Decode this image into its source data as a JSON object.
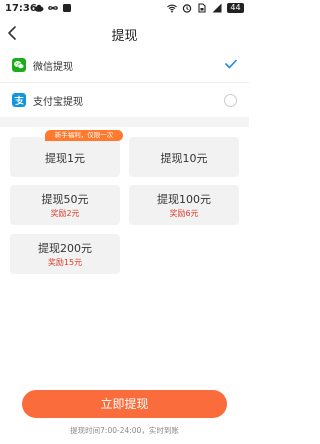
{
  "status_bar": {
    "time": "17:36",
    "battery": "44",
    "icons": [
      "cloud-icon",
      "infinity-icon",
      "app-icon",
      "wifi-icon",
      "alarm-icon",
      "sim-icon",
      "signal-icon"
    ]
  },
  "header": {
    "title": "提现",
    "back_icon": "back-arrow-icon"
  },
  "payment_methods": [
    {
      "label": "微信提现",
      "icon": "wechat-icon",
      "selected": true,
      "color": "#1aad19"
    },
    {
      "label": "支付宝提现",
      "icon": "alipay-icon",
      "selected": false,
      "color": "#1296db"
    }
  ],
  "promo_tag": "新手福利，仅限一次",
  "options": [
    {
      "label": "提现1元",
      "reward": ""
    },
    {
      "label": "提现10元",
      "reward": ""
    },
    {
      "label": "提现50元",
      "reward": "奖励2元"
    },
    {
      "label": "提现100元",
      "reward": "奖励6元"
    },
    {
      "label": "提现200元",
      "reward": "奖励15元"
    }
  ],
  "submit_label": "立即提现",
  "footnote": "提现时间7:00-24:00，实时到账",
  "colors": {
    "accent": "#fb6c3c",
    "check": "#1e88e5",
    "reward": "#e03a2b"
  }
}
